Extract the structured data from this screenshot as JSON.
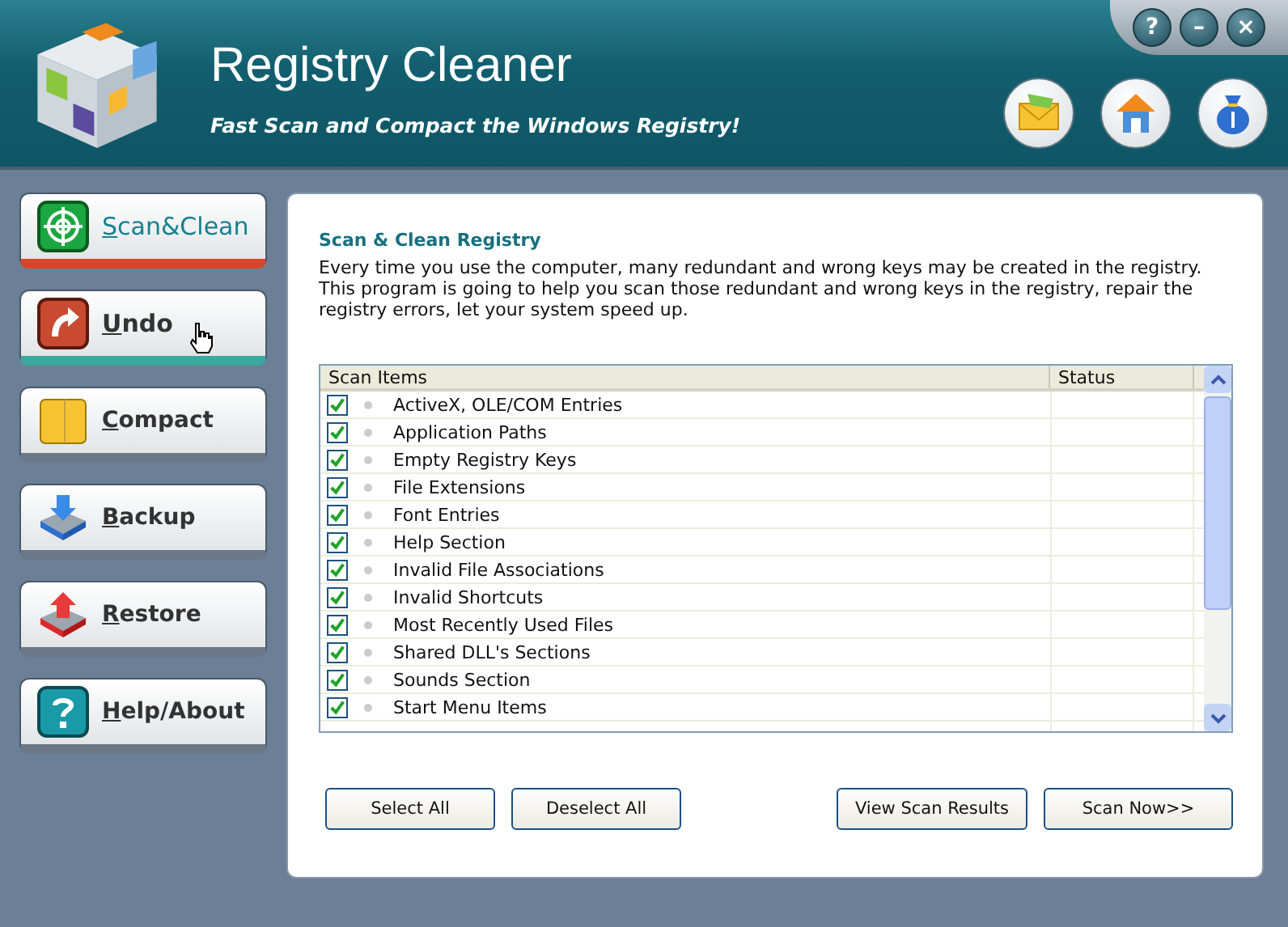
{
  "window": {
    "title": "Registry Cleaner",
    "subtitle": "Fast Scan and Compact the Windows Registry!",
    "controls": [
      "?",
      "–",
      "×"
    ]
  },
  "nav": [
    {
      "kind": "scan",
      "label": "Scan&Clean",
      "selected": true,
      "hovered": false
    },
    {
      "kind": "undo",
      "label": "Undo",
      "selected": false,
      "hovered": true
    },
    {
      "kind": "compact",
      "label": "Compact",
      "selected": false,
      "hovered": false
    },
    {
      "kind": "backup",
      "label": "Backup",
      "selected": false,
      "hovered": false
    },
    {
      "kind": "restore",
      "label": "Restore",
      "selected": false,
      "hovered": false
    },
    {
      "kind": "help",
      "label": "Help/About",
      "selected": false,
      "hovered": false
    }
  ],
  "panel": {
    "title": "Scan & Clean Registry",
    "description": "Every time you use the computer, many redundant and wrong keys may be created in the registry. This program is going to help you scan those redundant and wrong keys in the registry, repair the registry errors, let your system speed up."
  },
  "table": {
    "columns": [
      "Scan Items",
      "Status"
    ],
    "rows": [
      {
        "name": "ActiveX, OLE/COM Entries",
        "checked": true
      },
      {
        "name": "Application Paths",
        "checked": true
      },
      {
        "name": "Empty Registry Keys",
        "checked": true
      },
      {
        "name": "File Extensions",
        "checked": true
      },
      {
        "name": "Font Entries",
        "checked": true
      },
      {
        "name": "Help Section",
        "checked": true
      },
      {
        "name": "Invalid File Associations",
        "checked": true
      },
      {
        "name": "Invalid Shortcuts",
        "checked": true
      },
      {
        "name": "Most Recently Used Files",
        "checked": true
      },
      {
        "name": "Shared DLL's Sections",
        "checked": true
      },
      {
        "name": "Sounds Section",
        "checked": true
      },
      {
        "name": "Start Menu Items",
        "checked": true
      }
    ]
  },
  "buttons_left": [
    "Select All",
    "Deselect All"
  ],
  "buttons_right": [
    "View Scan Results",
    "Scan Now>>"
  ]
}
